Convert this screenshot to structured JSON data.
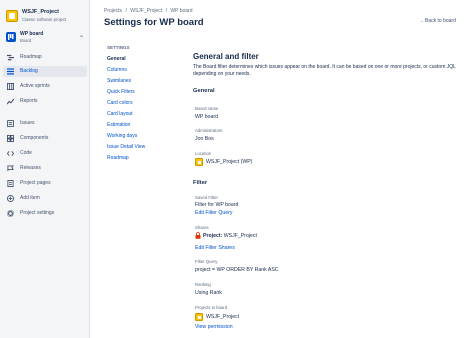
{
  "colors": {
    "accent": "#0052CC",
    "sidebar_bg": "#F4F5F7",
    "project_avatar": "#FFC400",
    "text": "#172B4D",
    "subtle": "#5E6C84"
  },
  "sidebar": {
    "project_name": "WSJF_Project",
    "project_type": "Classic software project",
    "board_name": "WP board",
    "board_sub": "Board",
    "items": [
      {
        "label": "Roadmap",
        "icon": "roadmap-icon",
        "active": false
      },
      {
        "label": "Backlog",
        "icon": "backlog-icon",
        "active": true
      },
      {
        "label": "Active sprints",
        "icon": "sprints-icon",
        "active": false
      },
      {
        "label": "Reports",
        "icon": "reports-icon",
        "active": false
      },
      {
        "label": "Issues",
        "icon": "issues-icon",
        "active": false
      },
      {
        "label": "Components",
        "icon": "components-icon",
        "active": false
      },
      {
        "label": "Code",
        "icon": "code-icon",
        "active": false
      },
      {
        "label": "Releases",
        "icon": "releases-icon",
        "active": false
      },
      {
        "label": "Project pages",
        "icon": "pages-icon",
        "active": false
      },
      {
        "label": "Add item",
        "icon": "add-icon",
        "active": false
      },
      {
        "label": "Project settings",
        "icon": "settings-icon",
        "active": false
      }
    ]
  },
  "header": {
    "breadcrumb": [
      "Projects",
      "/",
      "WSJF_Project",
      "/",
      "WP board"
    ],
    "title": "Settings for WP board",
    "back_link": "Back to board"
  },
  "settings_nav": {
    "heading": "SETTINGS",
    "items": [
      "General",
      "Columns",
      "Swimlanes",
      "Quick Filters",
      "Card colors",
      "Card layout",
      "Estimation",
      "Working days",
      "Issue Detail View",
      "Roadmap"
    ]
  },
  "main": {
    "title": "General and filter",
    "description": "The Board filter determines which issues appear on the board. It can be based on one or more projects, or custom JQL depending on your needs.",
    "general": {
      "heading": "General",
      "board_name_label": "Board name",
      "board_name": "WP board",
      "admins_label": "Administrators",
      "admins": "Jon Bos",
      "location_label": "Location",
      "location": "WSJF_Project (WP)"
    },
    "filter": {
      "heading": "Filter",
      "saved_filter_label": "Saved Filter",
      "saved_filter": "Filter for WP board",
      "edit_filter_query": "Edit Filter Query",
      "shares_label": "Shares",
      "shares_prefix": "Project:",
      "shares_value": "WSJF_Project",
      "edit_filter_shares": "Edit Filter Shares",
      "filter_query_label": "Filter Query",
      "filter_query": "project = WP ORDER BY Rank ASC",
      "ranking_label": "Ranking",
      "ranking": "Using Rank",
      "projects_label": "Projects in board",
      "project": "WSJF_Project",
      "view_permission": "View permission"
    }
  }
}
